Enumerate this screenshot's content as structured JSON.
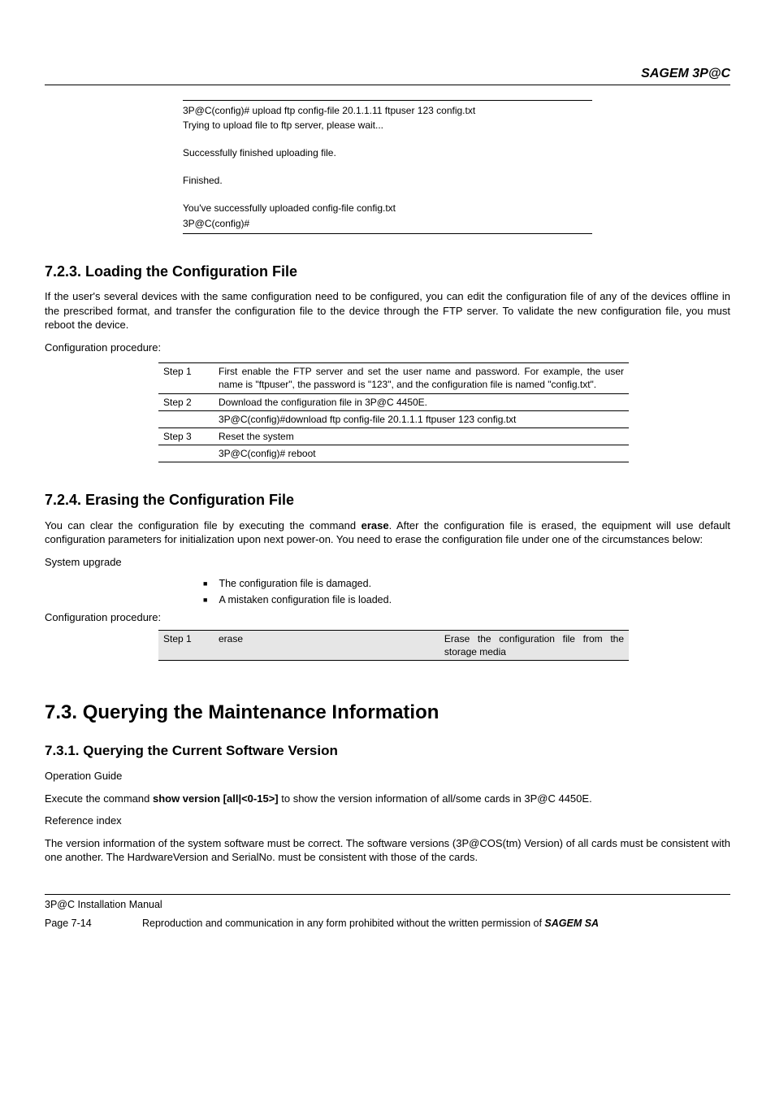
{
  "brand": "SAGEM 3P@C",
  "codeblock": {
    "l1": "3P@C(config)# upload ftp config-file 20.1.1.11 ftpuser 123 config.txt",
    "l2": "Trying to upload file to ftp server, please wait...",
    "l3": "Successfully finished uploading file.",
    "l4": "Finished.",
    "l5": "You've successfully uploaded config-file config.txt",
    "l6": "3P@C(config)#"
  },
  "s723": {
    "heading": "7.2.3. Loading the Configuration File",
    "para": "If the user's several devices with the same configuration need to be configured, you can edit the configuration file of any of the devices offline in the prescribed format, and transfer the configuration file to the device through the FTP server. To validate the new configuration file, you must reboot the device.",
    "cp": "Configuration procedure:",
    "rows": {
      "s1l": "Step 1",
      "s1t": "First enable the FTP server and set the user name and password. For example, the user name is \"ftpuser\", the password is \"123\", and the configuration file is named \"config.txt\".",
      "s2l": "Step 2",
      "s2t": "Download the configuration file in 3P@C 4450E.",
      "s2c": "3P@C(config)#download ftp config-file 20.1.1.1 ftpuser 123 config.txt",
      "s3l": "Step 3",
      "s3t": "Reset the system",
      "s3c": "3P@C(config)# reboot"
    }
  },
  "s724": {
    "heading": "7.2.4. Erasing the Configuration File",
    "para": "You can clear the configuration file by executing the command erase. After the configuration file is erased, the equipment will use default configuration parameters for initialization upon next power-on. You need to erase the configuration file under one of the circumstances below:",
    "para_pre": "You can clear the configuration file by executing the command ",
    "para_cmd": "erase",
    "para_post": ". After the configuration file is erased, the equipment will use default configuration parameters for initialization upon next power-on. You need to erase the configuration file under one of the circumstances below:",
    "sys": "System upgrade",
    "b1": "The configuration file is damaged.",
    "b2": "A mistaken configuration file is loaded.",
    "cp": "Configuration procedure:",
    "rows": {
      "s1l": "Step 1",
      "s1c": "erase",
      "s1d": "Erase the configuration file from the storage media"
    }
  },
  "s73": {
    "heading": "7.3. Querying the Maintenance Information"
  },
  "s731": {
    "heading": "7.3.1. Querying the Current Software Version",
    "og": "Operation Guide",
    "p_pre": "Execute the command ",
    "p_cmd": "show version [all|<0-15>]",
    "p_post": " to show the version information of all/some cards in 3P@C 4450E.",
    "ri": "Reference index",
    "p2": "The version information of the system software must be correct. The software versions (3P@COS(tm) Version) of all cards must be consistent with one another. The HardwareVersion and SerialNo. must be consistent with those of the cards."
  },
  "footer": {
    "manual": "3P@C Installation Manual",
    "page": "Page 7-14",
    "repro": "Reproduction and communication in any form prohibited without the written permission of ",
    "sa": "SAGEM SA"
  }
}
